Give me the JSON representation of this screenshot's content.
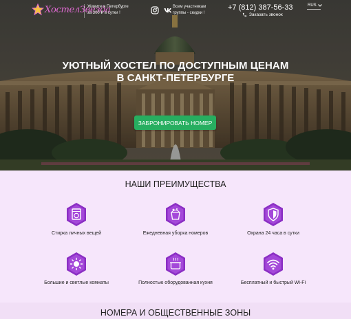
{
  "header": {
    "logo_text": "ХостелЗвезда",
    "tagline": "Живите в Петербурге за 300 ₽ в сутки !",
    "social_text": "Всем участникам группы - скидки !",
    "phone": "+7 (812) 387-56-33",
    "callback_label": "Заказать звонок",
    "lang": "RUS"
  },
  "hero": {
    "headline_line1": "УЮТНЫЙ ХОСТЕЛ ПО ДОСТУПНЫМ ЦЕНАМ",
    "headline_line2": "В САНКТ-ПЕТЕРБУРГЕ",
    "cta_label": "ЗАБРОНИРОВАТЬ НОМЕР"
  },
  "advantages": {
    "title": "НАШИ ПРЕИМУЩЕСТВА",
    "items": [
      {
        "label": "Стирка личных вещей",
        "icon": "washing-machine-icon"
      },
      {
        "label": "Ежедневная уборка номеров",
        "icon": "cleaning-bucket-icon"
      },
      {
        "label": "Охрана 24 часа в сутки",
        "icon": "shield-icon"
      },
      {
        "label": "Большие и светлые комнаты",
        "icon": "sun-icon"
      },
      {
        "label": "Полностью оборудованная кухня",
        "icon": "cooking-pot-icon"
      },
      {
        "label": "Бесплатный и быстрый Wi-Fi",
        "icon": "wifi-icon"
      }
    ]
  },
  "rooms": {
    "title": "НОМЕРА И ОБЩЕСТВЕННЫЕ ЗОНЫ"
  },
  "colors": {
    "accent_purple": "#8b2fc4",
    "cta_green": "#27ae60",
    "section_bg": "#f6e6fb",
    "logo_pink": "#e46bd6"
  }
}
